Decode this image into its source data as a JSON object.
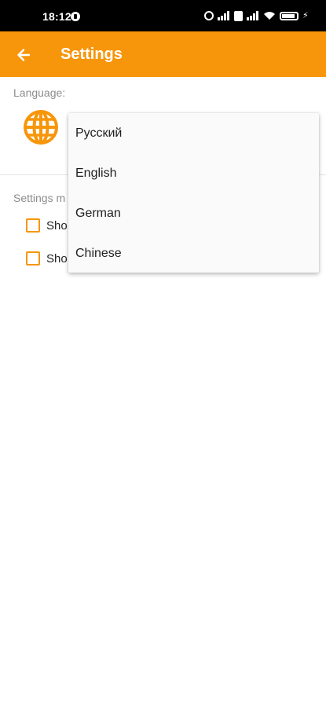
{
  "status_bar": {
    "time": "18:12",
    "icons": [
      "alarm-icon",
      "signal-icon",
      "sim-icon",
      "signal-icon",
      "wifi-icon",
      "battery-icon",
      "charging-bolt-icon"
    ],
    "battery_level": "82"
  },
  "app_bar": {
    "title": "Settings",
    "back_icon": "arrow-left-icon",
    "color": "#f7960a"
  },
  "language_section": {
    "label": "Language:",
    "icon": "globe-icon"
  },
  "settings_section": {
    "label": "Settings m",
    "options": [
      {
        "label": "Sho",
        "checked": false
      },
      {
        "label": "Sho",
        "checked": false
      }
    ]
  },
  "dropdown": {
    "items": [
      "Русский",
      "English",
      "German",
      "Chinese"
    ]
  }
}
